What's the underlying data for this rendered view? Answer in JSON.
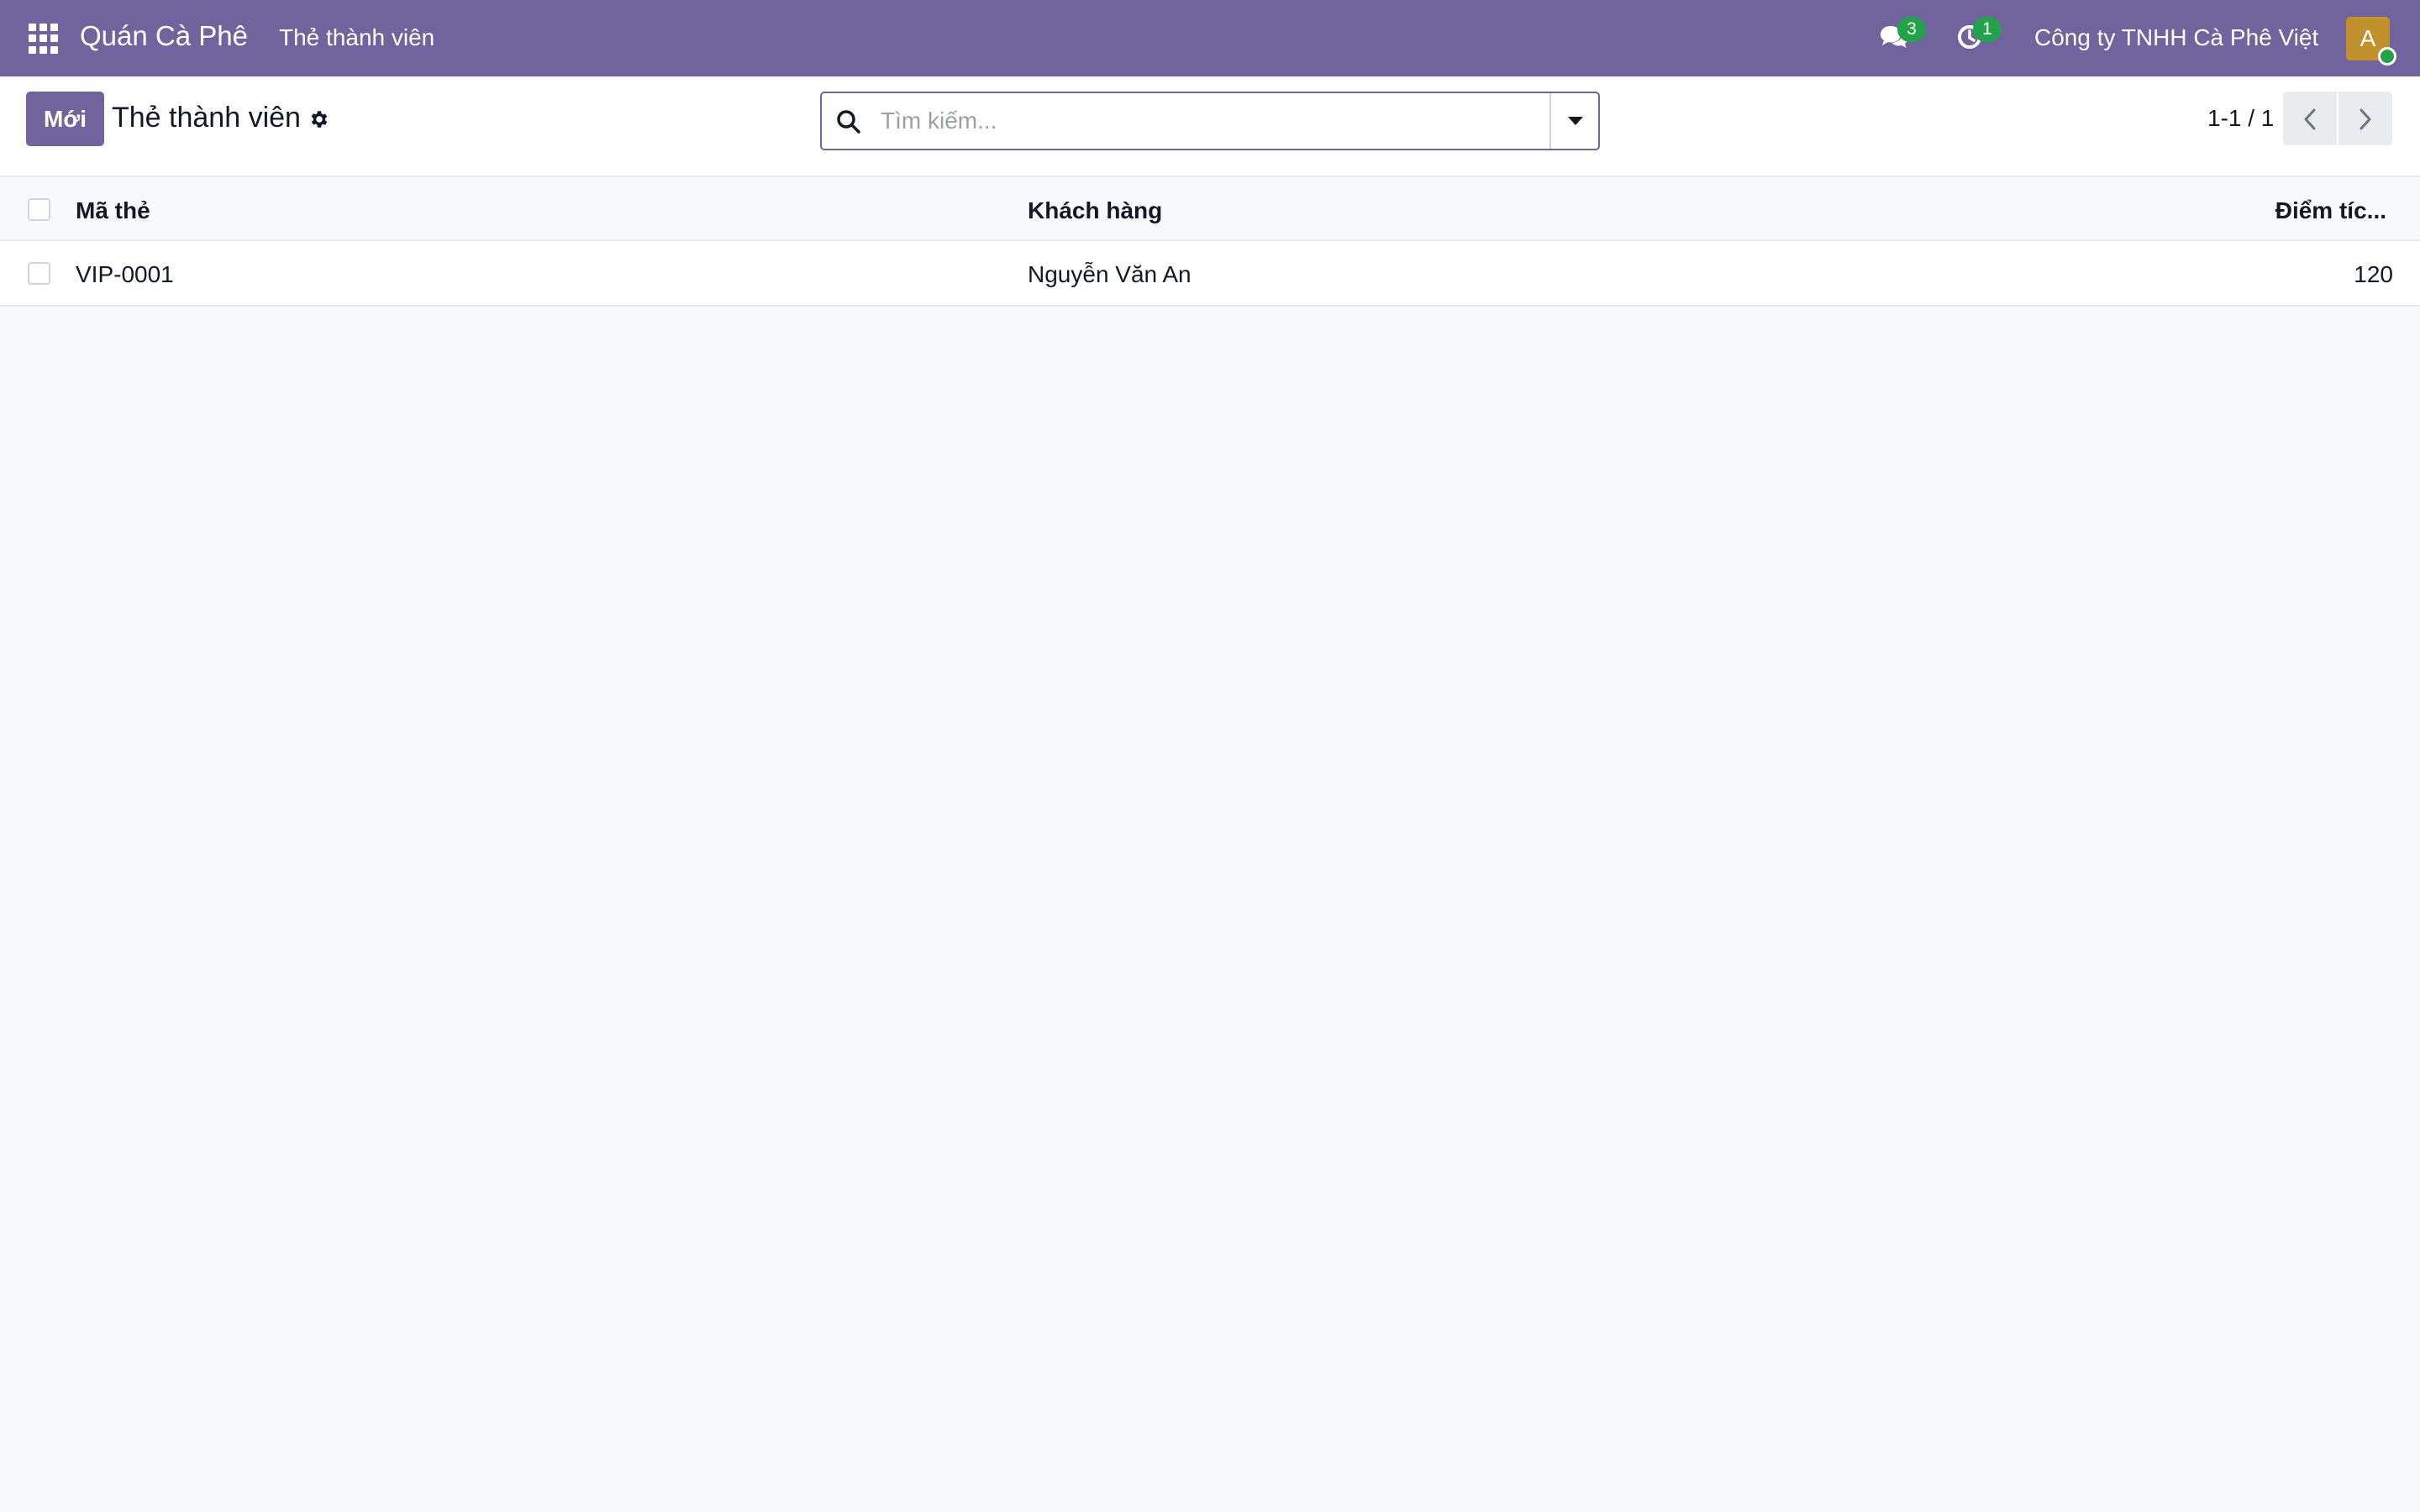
{
  "navbar": {
    "app_name": "Quán Cà Phê",
    "menu_item": "Thẻ thành viên",
    "messages_count": "3",
    "activities_count": "1",
    "company": "Công ty TNHH Cà Phê Việt",
    "avatar_initial": "A"
  },
  "control_panel": {
    "new_label": "Mới",
    "title": "Thẻ thành viên",
    "search_placeholder": "Tìm kiếm...",
    "pager": "1-1 / 1"
  },
  "table": {
    "columns": [
      "Mã thẻ",
      "Khách hàng",
      "Điểm tíc..."
    ],
    "rows": [
      [
        "VIP-0001",
        "Nguyễn Văn An",
        "120"
      ]
    ]
  },
  "colors": {
    "brand": "#71639e",
    "badge": "#22a34a",
    "avatar": "#c0912d"
  }
}
